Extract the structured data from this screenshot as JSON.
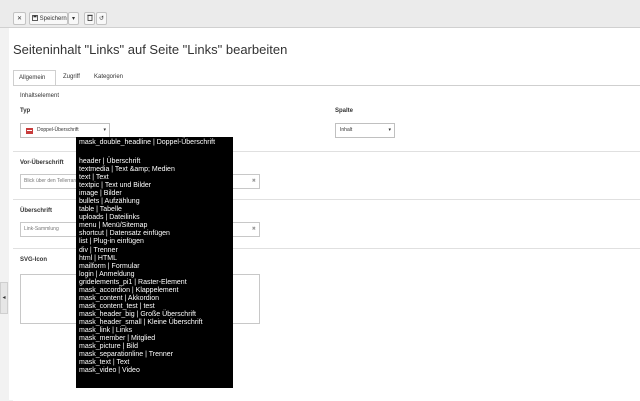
{
  "toolbar": {
    "close_icon": "close-icon",
    "save_label": "Speichern",
    "save_icon": "floppy-disk-icon",
    "dropdown_icon": "chevron-down-icon",
    "delete_icon": "trash-icon",
    "undo_icon": "undo-icon"
  },
  "page": {
    "title": "Seiteninhalt \"Links\" auf Seite \"Links\" bearbeiten"
  },
  "tabs": [
    {
      "label": "Allgemein",
      "active": true
    },
    {
      "label": "Zugriff",
      "active": false
    },
    {
      "label": "Kategorien",
      "active": false
    }
  ],
  "form": {
    "section_title": "Inhaltselement",
    "type": {
      "label": "Typ",
      "value": "Doppel-Überschrift"
    },
    "column": {
      "label": "Spalte",
      "value": "Inhalt"
    },
    "pre_heading": {
      "label": "Vor-Überschrift",
      "value": "Blick über den Tellerrand"
    },
    "heading": {
      "label": "Überschrift",
      "value": "Link-Sammlung"
    },
    "svg_icon": {
      "label": "SVG-Icon"
    }
  },
  "dropdown": {
    "selected": "mask_double_headline | Doppel-Überschrift",
    "options": [
      "header | Überschrift",
      "textmedia | Text &amp; Medien",
      "text | Text",
      "textpic | Text und Bilder",
      "image | Bilder",
      "bullets | Aufzählung",
      "table | Tabelle",
      "uploads | Dateilinks",
      "menu | Menü/Sitemap",
      "shortcut | Datensatz einfügen",
      "list | Plug-in einfügen",
      "div | Trenner",
      "html | HTML",
      "mailform | Formular",
      "login | Anmeldung",
      "gridelements_pi1 | Raster-Element",
      "mask_accordion | Klappelement",
      "mask_content | Akkordion",
      "mask_content_test | test",
      "mask_header_big | Große Überschrift",
      "mask_header_small | Kleine Überschrift",
      "mask_link | Links",
      "mask_member | Mitglied",
      "mask_picture | Bild",
      "mask_separationline | Trenner",
      "mask_text | Text",
      "mask_video | Video"
    ]
  }
}
